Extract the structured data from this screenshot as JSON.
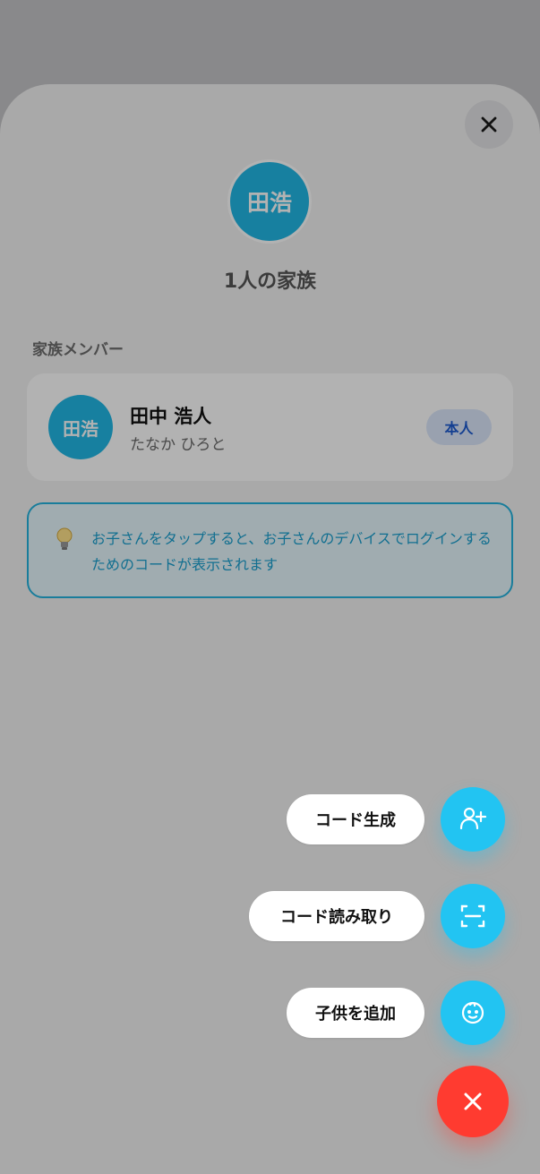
{
  "header": {
    "avatar_text": "田浩",
    "family_count": "1人の家族",
    "close_icon": "close-icon"
  },
  "section": {
    "label": "家族メンバー"
  },
  "member": {
    "avatar_text": "田浩",
    "name": "田中 浩人",
    "kana": "たなか ひろと",
    "badge": "本人"
  },
  "info": {
    "icon": "lightbulb-icon",
    "text": "お子さんをタップすると、お子さんのデバイスでログインするためのコードが表示されます"
  },
  "fab_menu": {
    "items": [
      {
        "label": "コード生成",
        "icon": "user-plus-icon"
      },
      {
        "label": "コード読み取り",
        "icon": "scan-icon"
      },
      {
        "label": "子供を追加",
        "icon": "baby-face-icon"
      }
    ],
    "main_icon": "close-icon"
  },
  "colors": {
    "accent": "#22c4f2",
    "avatar": "#22b8e6",
    "close_fab": "#ff3b30",
    "badge_bg": "#dbe7fb",
    "badge_text": "#1d5bd0",
    "info_border": "#25b3de",
    "info_bg": "#e6f6fc"
  }
}
